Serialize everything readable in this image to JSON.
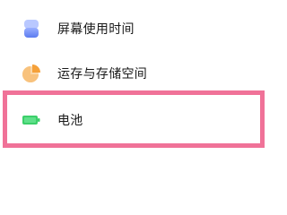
{
  "settings_list": {
    "items": [
      {
        "label": "屏幕使用时间",
        "icon": "screen-time-icon",
        "color": "#6d8af5"
      },
      {
        "label": "运存与存储空间",
        "icon": "storage-pie-icon",
        "color": "#f5a13a"
      },
      {
        "label": "电池",
        "icon": "battery-icon",
        "color": "#3ccf6a"
      }
    ]
  },
  "highlight": {
    "color": "#f07298"
  }
}
